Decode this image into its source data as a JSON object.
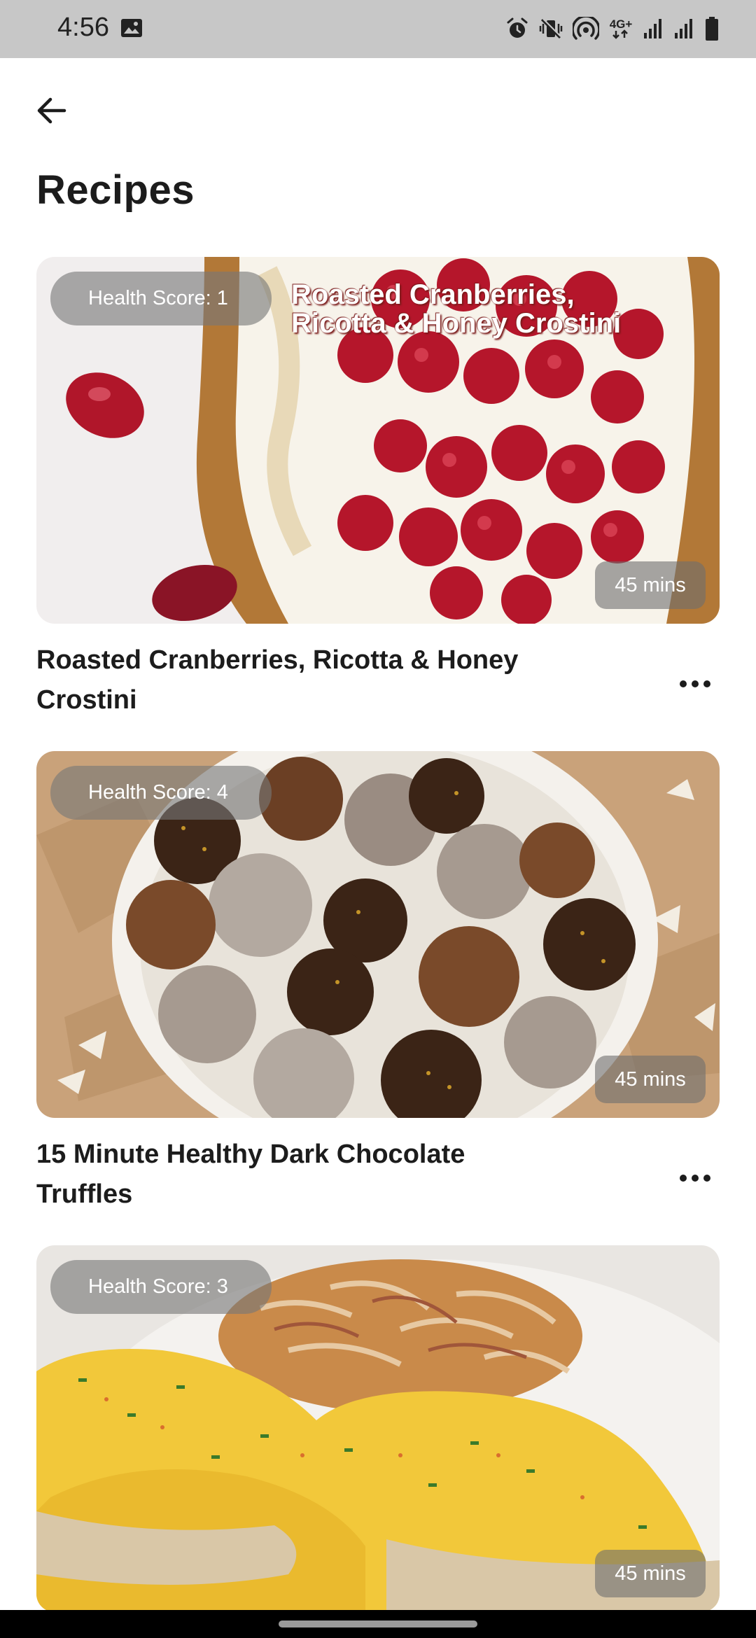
{
  "status_bar": {
    "time": "4:56",
    "network_label": "4G+",
    "icons": [
      "gallery-icon",
      "alarm-icon",
      "vibrate-icon",
      "hotspot-icon",
      "network-type-icon",
      "signal-icon",
      "signal-icon",
      "battery-icon"
    ]
  },
  "header": {
    "back_icon": "arrow-left-icon",
    "title": "Recipes"
  },
  "recipes": [
    {
      "title": "Roasted Cranberries, Ricotta & Honey Crostini",
      "health_score": "Health Score: 1",
      "time": "45 mins",
      "image_overlay_text": "Roasted Cranberries, Ricotta & Honey Crostini",
      "more_icon": "more-horizontal-icon"
    },
    {
      "title": "15 Minute Healthy Dark Chocolate Truffles",
      "health_score": "Health Score: 4",
      "time": "45 mins",
      "more_icon": "more-horizontal-icon"
    },
    {
      "health_score": "Health Score: 3",
      "time": "45 mins"
    }
  ],
  "colors": {
    "status_bar_bg": "#c7c7c7",
    "text": "#1c1c1c",
    "pill_bg": "rgba(120,120,120,0.62)",
    "nav_bar_bg": "#000000"
  }
}
